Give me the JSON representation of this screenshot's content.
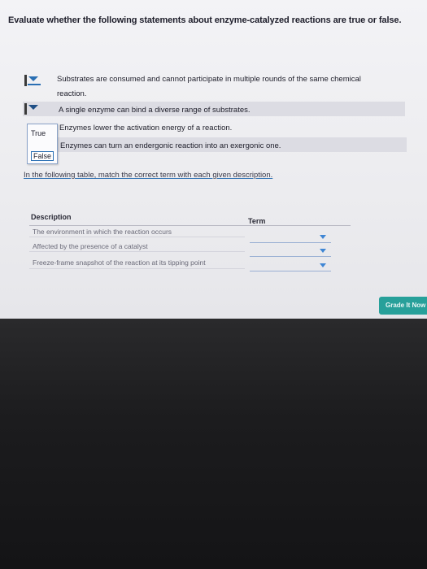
{
  "question": {
    "title": "Evaluate whether the following statements about enzyme-catalyzed reactions are true or false."
  },
  "statements": [
    {
      "line1": "Substrates are consumed and cannot participate in multiple rounds of the same chemical",
      "line2": "reaction."
    },
    {
      "line1": "A single enzyme can bind a diverse range of substrates."
    },
    {
      "line1": "Enzymes lower the activation energy of a reaction."
    },
    {
      "line1": "Enzymes can turn an endergonic reaction into an exergonic one."
    }
  ],
  "dropdown_menu": {
    "options": [
      "True",
      "False"
    ]
  },
  "matching": {
    "instruction": "In the following table, match the correct term with each given description.",
    "header_description": "Description",
    "header_term": "Term",
    "rows": [
      {
        "description": "The environment in which the reaction occurs",
        "term_value": ""
      },
      {
        "description": "Affected by the presence of a catalyst",
        "term_value": ""
      },
      {
        "description": "Freeze-frame snapshot of the reaction at its tipping point",
        "term_value": ""
      }
    ]
  },
  "buttons": {
    "grade": "Grade It Now"
  },
  "colors": {
    "accent_blue": "#2a6fb3",
    "grade_button": "#27a09a"
  }
}
